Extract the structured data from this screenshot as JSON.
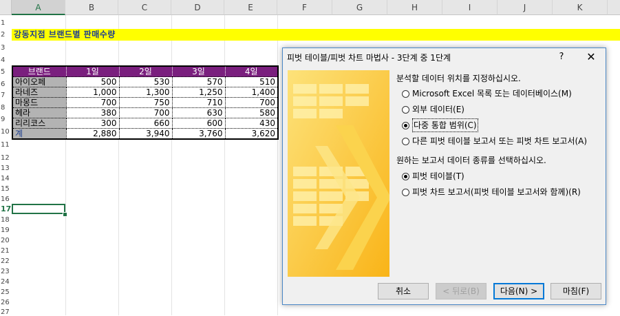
{
  "columns": [
    "A",
    "B",
    "C",
    "D",
    "E",
    "F",
    "G",
    "H",
    "I",
    "J",
    "K"
  ],
  "rows": [
    "1",
    "2",
    "3",
    "4",
    "5",
    "6",
    "7",
    "8",
    "9",
    "10",
    "11",
    "12",
    "13",
    "14",
    "15",
    "16",
    "17",
    "18",
    "19",
    "20",
    "21",
    "22",
    "23",
    "24",
    "25",
    "26",
    "27"
  ],
  "active_column": "A",
  "active_row": "17",
  "title": "강동지점 브랜드별 판매수량",
  "table": {
    "header": [
      "브랜드",
      "1일",
      "2일",
      "3일",
      "4일"
    ],
    "rows": [
      [
        "아이오페",
        "500",
        "530",
        "570",
        "510"
      ],
      [
        "라네즈",
        "1,000",
        "1,300",
        "1,250",
        "1,400"
      ],
      [
        "마몽드",
        "700",
        "750",
        "710",
        "700"
      ],
      [
        "헤라",
        "380",
        "700",
        "630",
        "580"
      ],
      [
        "리리코스",
        "300",
        "660",
        "600",
        "430"
      ]
    ],
    "total": [
      "계",
      "2,880",
      "3,940",
      "3,760",
      "3,620"
    ]
  },
  "dialog": {
    "title": "피벗 테이블/피벗 차트 마법사 - 3단계 중 1단계",
    "help": "?",
    "close": "✕",
    "section1": "분석할 데이터 위치를 지정하십시오.",
    "source_options": [
      "Microsoft Excel 목록 또는 데이터베이스(M)",
      "외부 데이터(E)",
      "다중 통합 범위(C)",
      "다른 피벗 테이블 보고서 또는 피벗 차트 보고서(A)"
    ],
    "source_selected": 2,
    "section2": "원하는 보고서 데이터 종류를 선택하십시오.",
    "report_options": [
      "피벗 테이블(T)",
      "피벗 차트 보고서(피벗 테이블 보고서와 함께)(R)"
    ],
    "report_selected": 0,
    "buttons": {
      "cancel": "취소",
      "back": "< 뒤로(B)",
      "next": "다음(N) >",
      "finish": "마침(F)"
    }
  },
  "colors": {
    "title_bg": "#ffff00",
    "title_text": "#1f3f8f",
    "header_bg": "#7a1f7e",
    "brand_bg": "#b3b3b3",
    "excel_green": "#217346",
    "art_yellow": "#fbc02d"
  }
}
